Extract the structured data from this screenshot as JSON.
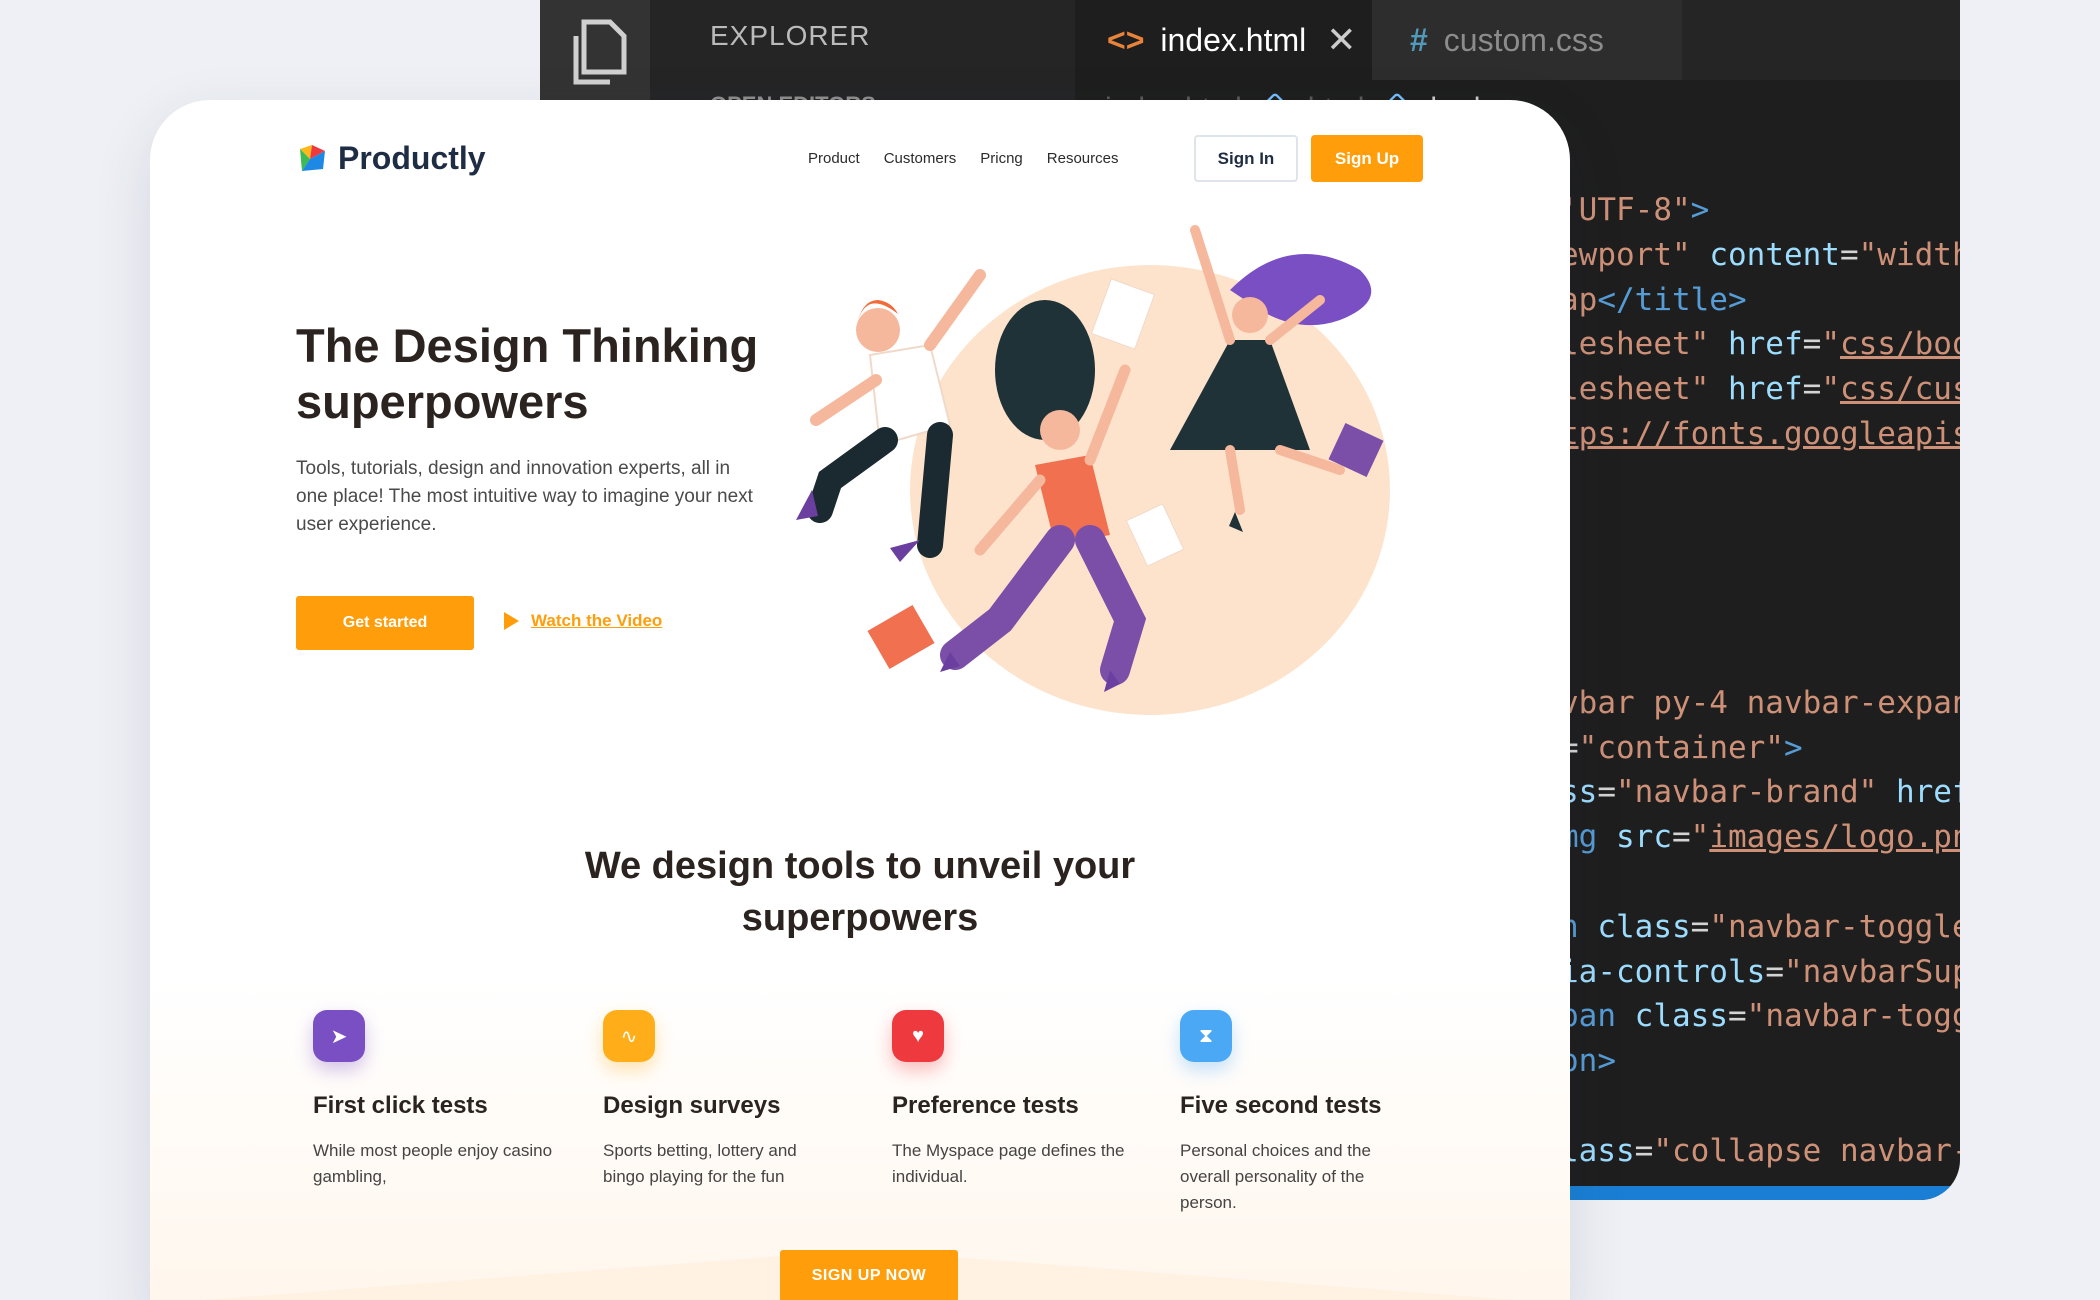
{
  "editor": {
    "explorer_title": "EXPLORER",
    "explorer_section": "OPEN EDITORS",
    "tabs": [
      {
        "label": "index.html",
        "icon": "<>",
        "active": true
      },
      {
        "label": "custom.css",
        "icon": "#",
        "active": false
      }
    ],
    "breadcrumb": [
      "index.html",
      "html",
      "body"
    ],
    "code_lines": [
      {
        "segments": [
          {
            "t": "'UTF-8\"",
            "c": "str"
          },
          {
            "t": ">",
            "c": "tag"
          }
        ]
      },
      {
        "segments": [
          {
            "t": "ewport\"",
            "c": "str"
          },
          {
            "t": " content",
            "c": "attr"
          },
          {
            "t": "=",
            "c": ""
          },
          {
            "t": "\"width",
            "c": "str"
          }
        ]
      },
      {
        "segments": [
          {
            "t": "ap",
            "c": "str"
          },
          {
            "t": "</title>",
            "c": "tag"
          }
        ]
      },
      {
        "segments": [
          {
            "t": "lesheet\"",
            "c": "str"
          },
          {
            "t": " href",
            "c": "attr"
          },
          {
            "t": "=",
            "c": ""
          },
          {
            "t": "\"",
            "c": "str"
          },
          {
            "t": "css/boo",
            "c": "link"
          }
        ]
      },
      {
        "segments": [
          {
            "t": "lesheet\"",
            "c": "str"
          },
          {
            "t": " href",
            "c": "attr"
          },
          {
            "t": "=",
            "c": ""
          },
          {
            "t": "\"",
            "c": "str"
          },
          {
            "t": "css/cus",
            "c": "link"
          }
        ]
      },
      {
        "segments": [
          {
            "t": "tps://fonts.googleapis",
            "c": "link"
          }
        ]
      },
      {
        "segments": []
      },
      {
        "segments": []
      },
      {
        "segments": []
      },
      {
        "segments": []
      },
      {
        "segments": []
      },
      {
        "segments": [
          {
            "t": "vbar py-4 navbar-expan",
            "c": "str"
          }
        ]
      },
      {
        "segments": [
          {
            "t": "=",
            "c": ""
          },
          {
            "t": "\"container\"",
            "c": "str"
          },
          {
            "t": ">",
            "c": "tag"
          }
        ]
      },
      {
        "segments": [
          {
            "t": "ss",
            "c": "attr"
          },
          {
            "t": "=",
            "c": ""
          },
          {
            "t": "\"navbar-brand\"",
            "c": "str"
          },
          {
            "t": " href",
            "c": "attr"
          }
        ]
      },
      {
        "segments": [
          {
            "t": "mg",
            "c": "tag"
          },
          {
            "t": " src",
            "c": "attr"
          },
          {
            "t": "=",
            "c": ""
          },
          {
            "t": "\"",
            "c": "str"
          },
          {
            "t": "images/logo.pn",
            "c": "link"
          }
        ]
      },
      {
        "segments": []
      },
      {
        "segments": [
          {
            "t": "n",
            "c": "tag"
          },
          {
            "t": " class",
            "c": "attr"
          },
          {
            "t": "=",
            "c": ""
          },
          {
            "t": "\"navbar-toggle",
            "c": "str"
          }
        ]
      },
      {
        "segments": [
          {
            "t": "ia-controls",
            "c": "attr"
          },
          {
            "t": "=",
            "c": ""
          },
          {
            "t": "\"navbarSup",
            "c": "str"
          }
        ]
      },
      {
        "segments": [
          {
            "t": "pan",
            "c": "tag"
          },
          {
            "t": " class",
            "c": "attr"
          },
          {
            "t": "=",
            "c": ""
          },
          {
            "t": "\"navbar-togg",
            "c": "str"
          }
        ]
      },
      {
        "segments": [
          {
            "t": "on>",
            "c": "tag"
          }
        ]
      },
      {
        "segments": []
      },
      {
        "segments": [
          {
            "t": "lass",
            "c": "attr"
          },
          {
            "t": "=",
            "c": ""
          },
          {
            "t": "\"collapse navbar-",
            "c": "str"
          }
        ]
      }
    ]
  },
  "site": {
    "brand": "Productly",
    "nav": [
      "Product",
      "Customers",
      "Pricng",
      "Resources"
    ],
    "signin": "Sign In",
    "signup": "Sign Up",
    "hero": {
      "title": "The Design Thinking superpowers",
      "text": "Tools, tutorials, design and innovation experts, all in one place! The most intuitive way to imagine your next user experience.",
      "cta": "Get started",
      "video": "Watch the Video"
    },
    "section_title": "We design tools to unveil your superpowers",
    "features": [
      {
        "title": "First click tests",
        "desc": "While most people enjoy casino gambling,",
        "color": "#7b4fc4",
        "icon": "cursor-icon",
        "glyph": "➤"
      },
      {
        "title": "Design surveys",
        "desc": "Sports betting, lottery and bingo playing for the fun",
        "color": "#ffae1a",
        "icon": "survey-icon",
        "glyph": "∿"
      },
      {
        "title": "Preference tests",
        "desc": "The Myspace page defines the individual.",
        "color": "#ee3a3f",
        "icon": "heart-icon",
        "glyph": "♥"
      },
      {
        "title": "Five second tests",
        "desc": "Personal choices and the overall personality of the person.",
        "color": "#4ba8f5",
        "icon": "hourglass-icon",
        "glyph": "⧗"
      }
    ],
    "signup_now": "SIGN UP NOW"
  }
}
